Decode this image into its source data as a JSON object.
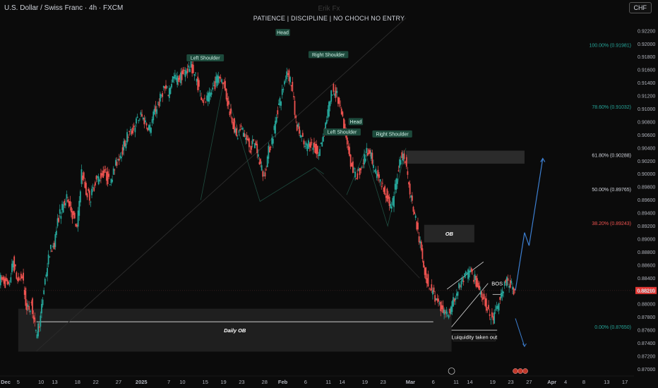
{
  "header": {
    "symbol_title": "U.S. Dollar / Swiss Franc · 4h · FXCM",
    "watermark": "Erik Fx",
    "subtitle": "PATIENCE  |  DISCIPLINE  |  NO CHOCH NO ENTRY",
    "currency_button": "CHF"
  },
  "chart_data": {
    "type": "candlestick",
    "symbol": "USDCHF",
    "timeframe": "4h",
    "ylim": [
      0.8695,
      0.9235
    ],
    "y_ticks": [
      "0.92200",
      "0.92000",
      "0.91800",
      "0.91600",
      "0.91400",
      "0.91200",
      "0.91000",
      "0.90800",
      "0.90600",
      "0.90400",
      "0.90200",
      "0.90000",
      "0.89800",
      "0.89600",
      "0.89400",
      "0.89200",
      "0.89000",
      "0.88800",
      "0.88600",
      "0.88400",
      "0.88200",
      "0.88000",
      "0.87800",
      "0.87600",
      "0.87400",
      "0.87200",
      "0.87000"
    ],
    "x_ticks": [
      "Dec",
      "5",
      "10",
      "13",
      "18",
      "22",
      "27",
      "2025",
      "7",
      "10",
      "15",
      "19",
      "23",
      "28",
      "Feb",
      "6",
      "11",
      "14",
      "19",
      "23",
      "Mar",
      "6",
      "11",
      "14",
      "19",
      "23",
      "27",
      "Apr",
      "4",
      "8",
      "13",
      "17"
    ],
    "x_range": [
      "2024-12-01",
      "2025-04-19"
    ],
    "x_tick_dates": [
      "2024-12-01",
      "2024-12-05",
      "2024-12-10",
      "2024-12-13",
      "2024-12-18",
      "2024-12-22",
      "2024-12-27",
      "2025-01-01",
      "2025-01-07",
      "2025-01-10",
      "2025-01-15",
      "2025-01-19",
      "2025-01-23",
      "2025-01-28",
      "2025-02-01",
      "2025-02-06",
      "2025-02-11",
      "2025-02-14",
      "2025-02-19",
      "2025-02-23",
      "2025-03-01",
      "2025-03-06",
      "2025-03-11",
      "2025-03-14",
      "2025-03-19",
      "2025-03-23",
      "2025-03-27",
      "2025-04-01",
      "2025-04-04",
      "2025-04-08",
      "2025-04-13",
      "2025-04-17"
    ],
    "price_path": [
      [
        "2024-12-01",
        0.8838
      ],
      [
        "2024-12-02",
        0.8836
      ],
      [
        "2024-12-03",
        0.8824
      ],
      [
        "2024-12-04",
        0.8866
      ],
      [
        "2024-12-05",
        0.8835
      ],
      [
        "2024-12-06",
        0.8843
      ],
      [
        "2024-12-07",
        0.8789
      ],
      [
        "2024-12-08",
        0.8802
      ],
      [
        "2024-12-09",
        0.8752
      ],
      [
        "2024-12-10",
        0.8779
      ],
      [
        "2024-12-11",
        0.8838
      ],
      [
        "2024-12-12",
        0.888
      ],
      [
        "2024-12-13",
        0.8893
      ],
      [
        "2024-12-14",
        0.8935
      ],
      [
        "2024-12-15",
        0.895
      ],
      [
        "2024-12-16",
        0.8964
      ],
      [
        "2024-12-17",
        0.8938
      ],
      [
        "2024-12-18",
        0.8915
      ],
      [
        "2024-12-19",
        0.9003
      ],
      [
        "2024-12-20",
        0.8972
      ],
      [
        "2024-12-21",
        0.8964
      ],
      [
        "2024-12-22",
        0.8989
      ],
      [
        "2024-12-23",
        0.8996
      ],
      [
        "2024-12-24",
        0.9003
      ],
      [
        "2024-12-25",
        0.8989
      ],
      [
        "2024-12-26",
        0.9003
      ],
      [
        "2024-12-27",
        0.9024
      ],
      [
        "2024-12-28",
        0.9038
      ],
      [
        "2024-12-29",
        0.9058
      ],
      [
        "2024-12-30",
        0.9065
      ],
      [
        "2024-12-31",
        0.908
      ],
      [
        "2025-01-01",
        0.909
      ],
      [
        "2025-01-02",
        0.908
      ],
      [
        "2025-01-03",
        0.907
      ],
      [
        "2025-01-04",
        0.9096
      ],
      [
        "2025-01-05",
        0.911
      ],
      [
        "2025-01-06",
        0.9132
      ],
      [
        "2025-01-07",
        0.9125
      ],
      [
        "2025-01-08",
        0.9148
      ],
      [
        "2025-01-09",
        0.9145
      ],
      [
        "2025-01-10",
        0.9152
      ],
      [
        "2025-01-11",
        0.916
      ],
      [
        "2025-01-12",
        0.9166
      ],
      [
        "2025-01-13",
        0.915
      ],
      [
        "2025-01-14",
        0.9125
      ],
      [
        "2025-01-15",
        0.911
      ],
      [
        "2025-01-16",
        0.9118
      ],
      [
        "2025-01-17",
        0.9135
      ],
      [
        "2025-01-18",
        0.9152
      ],
      [
        "2025-01-19",
        0.9145
      ],
      [
        "2025-01-20",
        0.911
      ],
      [
        "2025-01-21",
        0.9085
      ],
      [
        "2025-01-22",
        0.9055
      ],
      [
        "2025-01-23",
        0.907
      ],
      [
        "2025-01-24",
        0.9055
      ],
      [
        "2025-01-25",
        0.904
      ],
      [
        "2025-01-26",
        0.905
      ],
      [
        "2025-01-27",
        0.902
      ],
      [
        "2025-01-28",
        0.8995
      ],
      [
        "2025-01-29",
        0.9035
      ],
      [
        "2025-01-30",
        0.906
      ],
      [
        "2025-01-31",
        0.91
      ],
      [
        "2025-02-01",
        0.9125
      ],
      [
        "2025-02-02",
        0.916
      ],
      [
        "2025-02-03",
        0.914
      ],
      [
        "2025-02-04",
        0.908
      ],
      [
        "2025-02-05",
        0.906
      ],
      [
        "2025-02-06",
        0.904
      ],
      [
        "2025-02-07",
        0.905
      ],
      [
        "2025-02-08",
        0.904
      ],
      [
        "2025-02-09",
        0.903
      ],
      [
        "2025-02-10",
        0.906
      ],
      [
        "2025-02-11",
        0.9095
      ],
      [
        "2025-02-12",
        0.913
      ],
      [
        "2025-02-13",
        0.912
      ],
      [
        "2025-02-14",
        0.909
      ],
      [
        "2025-02-15",
        0.905
      ],
      [
        "2025-02-16",
        0.902
      ],
      [
        "2025-02-17",
        0.8995
      ],
      [
        "2025-02-18",
        0.9005
      ],
      [
        "2025-02-19",
        0.9025
      ],
      [
        "2025-02-20",
        0.904
      ],
      [
        "2025-02-21",
        0.901
      ],
      [
        "2025-02-22",
        0.8995
      ],
      [
        "2025-02-23",
        0.898
      ],
      [
        "2025-02-24",
        0.8965
      ],
      [
        "2025-02-25",
        0.8945
      ],
      [
        "2025-02-26",
        0.899
      ],
      [
        "2025-02-27",
        0.903
      ],
      [
        "2025-02-28",
        0.9022
      ],
      [
        "2025-03-01",
        0.897
      ],
      [
        "2025-03-02",
        0.894
      ],
      [
        "2025-03-03",
        0.89
      ],
      [
        "2025-03-04",
        0.886
      ],
      [
        "2025-03-05",
        0.883
      ],
      [
        "2025-03-06",
        0.882
      ],
      [
        "2025-03-07",
        0.88
      ],
      [
        "2025-03-08",
        0.879
      ],
      [
        "2025-03-09",
        0.8785
      ],
      [
        "2025-03-10",
        0.879
      ],
      [
        "2025-03-11",
        0.8815
      ],
      [
        "2025-03-12",
        0.883
      ],
      [
        "2025-03-13",
        0.884
      ],
      [
        "2025-03-14",
        0.885
      ],
      [
        "2025-03-15",
        0.8842
      ],
      [
        "2025-03-16",
        0.8825
      ],
      [
        "2025-03-17",
        0.8815
      ],
      [
        "2025-03-18",
        0.879
      ],
      [
        "2025-03-19",
        0.8775
      ],
      [
        "2025-03-20",
        0.879
      ],
      [
        "2025-03-21",
        0.8815
      ],
      [
        "2025-03-22",
        0.8835
      ],
      [
        "2025-03-23",
        0.883
      ],
      [
        "2025-03-24",
        0.8821
      ]
    ],
    "current_price": "0.88210",
    "fibonacci": [
      {
        "label": "100.00% (0.91981)",
        "price": 0.91981,
        "color": "#26a69a"
      },
      {
        "label": "78.60% (0.91032)",
        "price": 0.91032,
        "color": "#26a69a"
      },
      {
        "label": "61.80% (0.90288)",
        "price": 0.90288,
        "color": "#d1d4dc"
      },
      {
        "label": "50.00% (0.89765)",
        "price": 0.89765,
        "color": "#d1d4dc"
      },
      {
        "label": "38.20% (0.89243)",
        "price": 0.89243,
        "color": "#ef5350"
      },
      {
        "label": "0.00% (0.87650)",
        "price": 0.8765,
        "color": "#26a69a"
      }
    ],
    "patterns": [
      {
        "label": "Left Shoulder",
        "date": "2025-01-15",
        "price": 0.9177
      },
      {
        "label": "Head",
        "date": "2025-02-01",
        "price": 0.9216
      },
      {
        "label": "Right Shoulder",
        "date": "2025-02-11",
        "price": 0.9182
      },
      {
        "label": "Left Shoulder",
        "date": "2025-02-14",
        "price": 0.9063
      },
      {
        "label": "Head",
        "date": "2025-02-17",
        "price": 0.9079
      },
      {
        "label": "Right Shoulder",
        "date": "2025-02-25",
        "price": 0.906
      }
    ],
    "zones": [
      {
        "label": "",
        "x0": "2025-02-28",
        "x1": "2025-03-26",
        "p_hi": 0.9036,
        "p_lo": 0.9016,
        "shade": "#2b2b2b"
      },
      {
        "label": "OB",
        "x0": "2025-03-04",
        "x1": "2025-03-15",
        "p_hi": 0.8922,
        "p_lo": 0.8895,
        "shade": "#262626"
      },
      {
        "label": "Daily OB",
        "x0": "2024-12-05",
        "x1": "2025-03-10",
        "p_hi": 0.8793,
        "p_lo": 0.8727,
        "shade": "#1f1f1f"
      }
    ],
    "annotations": {
      "bos": "BOS",
      "liquidity": "Luiquidity taken out",
      "daily_ob": "Daily OB",
      "ob": "OB"
    },
    "projection": [
      [
        "2025-03-24",
        0.8821
      ],
      [
        "2025-03-26",
        0.891
      ],
      [
        "2025-03-27",
        0.889
      ],
      [
        "2025-03-30",
        0.9024
      ]
    ],
    "projection_down": [
      [
        "2025-03-24",
        0.8778
      ],
      [
        "2025-03-26",
        0.8735
      ]
    ]
  },
  "colors": {
    "up": "#26a69a",
    "down": "#ef5350",
    "price_label_bg": "#e53935",
    "projection": "#3d7fd1"
  }
}
